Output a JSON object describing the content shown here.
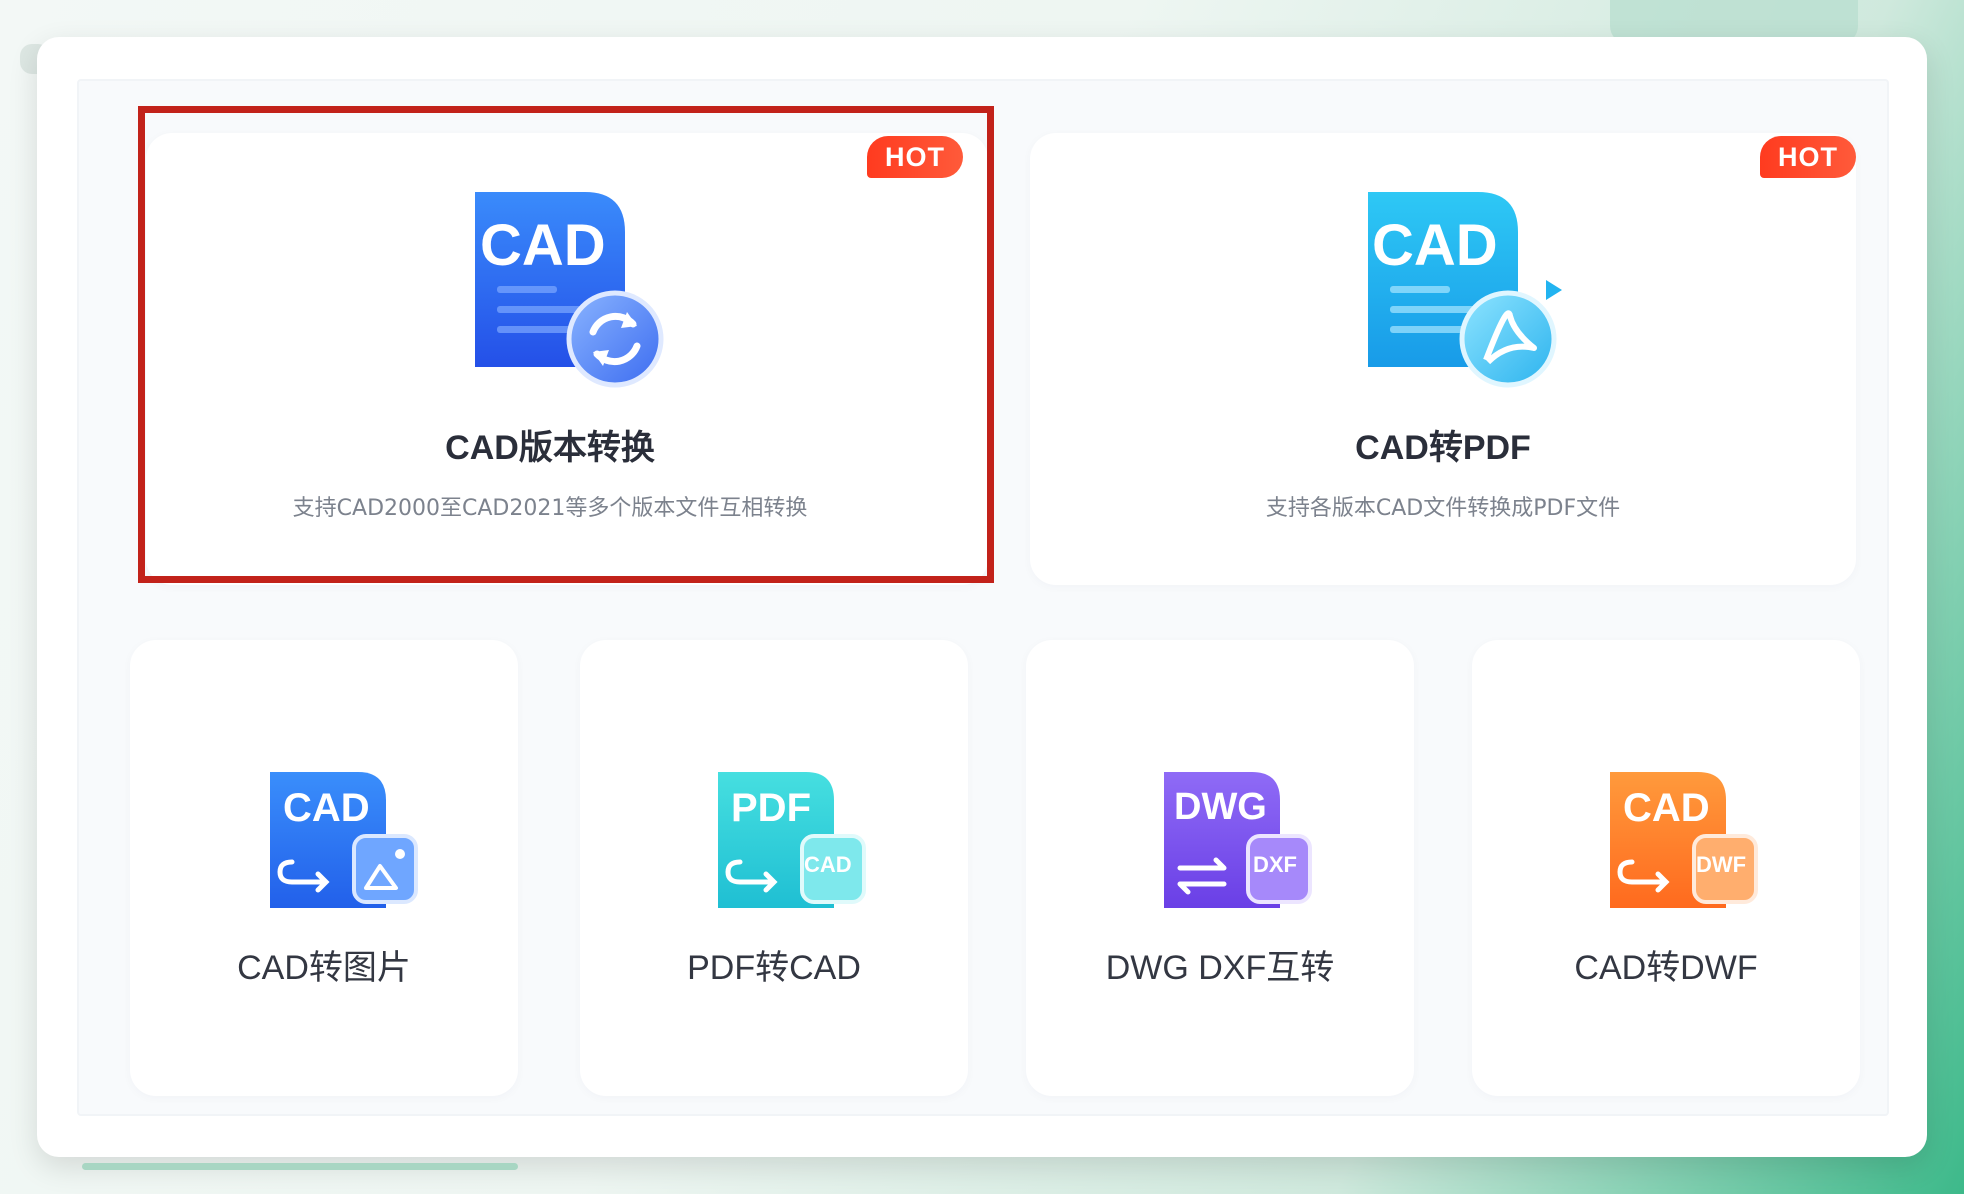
{
  "cards_top": [
    {
      "title": "CAD版本转换",
      "description": "支持CAD2000至CAD2021等多个版本文件互相转换",
      "badge": "HOT",
      "icon_label": "CAD",
      "icon": "convert-version-icon",
      "selected": true
    },
    {
      "title": "CAD转PDF",
      "description": "支持各版本CAD文件转换成PDF文件",
      "badge": "HOT",
      "icon_label": "CAD",
      "icon": "pdf-acrobat-icon",
      "selected": false
    }
  ],
  "cards_bottom": [
    {
      "title": "CAD转图片",
      "icon_label": "CAD",
      "sub_label": "",
      "icon": "image-icon",
      "color": "#2f7cf6"
    },
    {
      "title": "PDF转CAD",
      "icon_label": "PDF",
      "sub_label": "CAD",
      "icon": "cad-doc-icon",
      "color": "#2ccfd6"
    },
    {
      "title": "DWG DXF互转",
      "icon_label": "DWG",
      "sub_label": "DXF",
      "icon": "dxf-doc-icon",
      "color": "#7b52f0"
    },
    {
      "title": "CAD转DWF",
      "icon_label": "CAD",
      "sub_label": "DWF",
      "icon": "dwf-doc-icon",
      "color": "#ff7a26"
    }
  ],
  "colors": {
    "selection": "#c2221a",
    "hot_badge": "#ff3b1f",
    "accent_green": "#3db98a"
  }
}
